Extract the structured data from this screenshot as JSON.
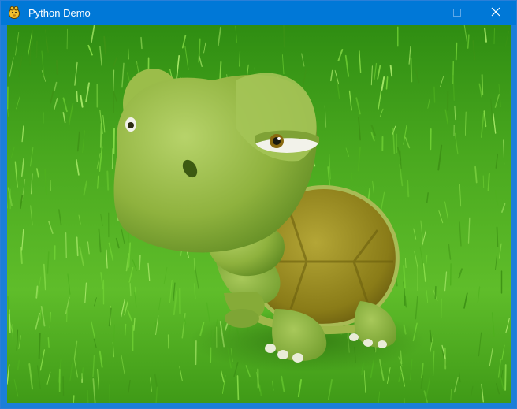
{
  "window": {
    "title": "Python Demo",
    "app_icon": "python-icon",
    "controls": [
      "minimize-icon",
      "maximize-icon",
      "close-icon"
    ],
    "accent_color": "#0078d7"
  },
  "scene": {
    "background": "grass",
    "subject": "cartoon-turtle",
    "colors": {
      "grass_dark": "#2f8a10",
      "grass_light": "#8ee046",
      "turtle_skin": "#8fb23e",
      "turtle_shell": "#8a7c18"
    }
  }
}
